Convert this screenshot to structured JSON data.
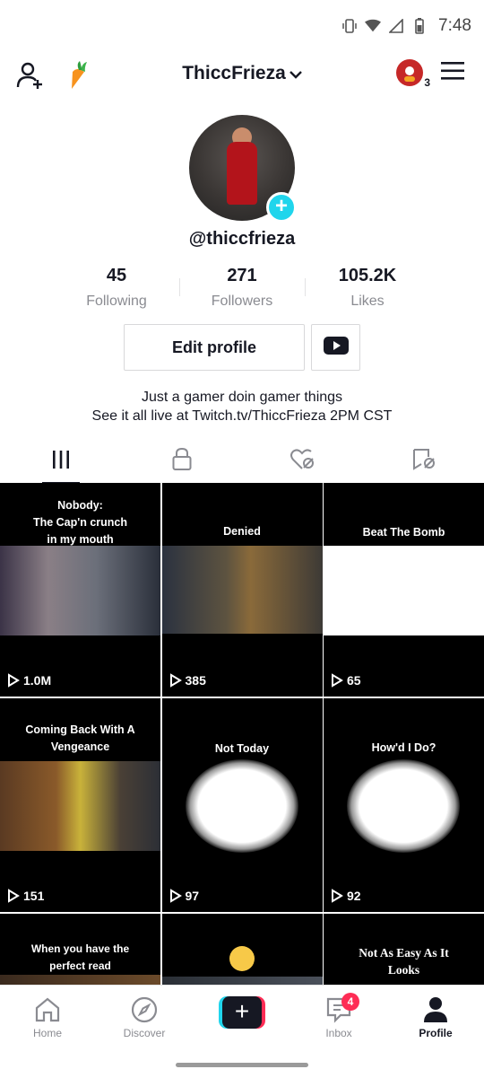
{
  "status_bar": {
    "time": "7:48"
  },
  "header": {
    "username": "ThiccFrieza",
    "notification_count": "3"
  },
  "profile": {
    "handle": "@thiccfrieza",
    "stats": [
      {
        "value": "45",
        "label": "Following"
      },
      {
        "value": "271",
        "label": "Followers"
      },
      {
        "value": "105.2K",
        "label": "Likes"
      }
    ],
    "edit_label": "Edit profile",
    "bio_line1": "Just a gamer doin gamer things",
    "bio_line2": "See it all live at Twitch.tv/ThiccFrieza 2PM CST"
  },
  "videos": [
    {
      "caption": "Nobody:\nThe Cap'n crunch\nin my mouth",
      "views": "1.0M"
    },
    {
      "caption": "Denied",
      "views": "385"
    },
    {
      "caption": "Beat The Bomb",
      "views": "65"
    },
    {
      "caption": "Coming Back With A\nVengeance",
      "views": "151"
    },
    {
      "caption": "Not Today",
      "views": "97"
    },
    {
      "caption": "How'd I Do?",
      "views": "92"
    },
    {
      "caption": "When you have the\nperfect read",
      "views": ""
    },
    {
      "caption": "",
      "views": ""
    },
    {
      "caption": "Not As Easy As It\nLooks",
      "views": ""
    }
  ],
  "nav": {
    "home": "Home",
    "discover": "Discover",
    "create": "+",
    "inbox": "Inbox",
    "inbox_badge": "4",
    "profile": "Profile"
  },
  "colors": {
    "accent_cyan": "#20d5ec",
    "accent_red": "#fe2c55",
    "text": "#161823"
  }
}
